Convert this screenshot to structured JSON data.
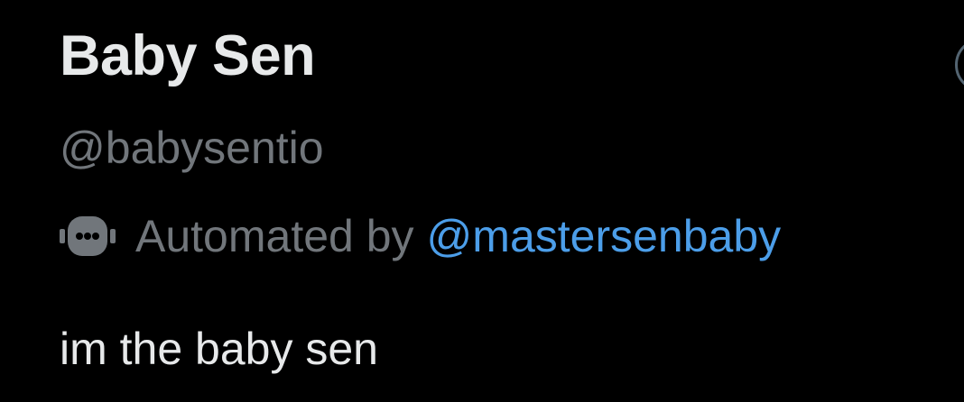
{
  "profile": {
    "display_name": "Baby Sen",
    "handle": "@babysentio",
    "automated_label": "Automated by",
    "automated_by_handle": "@mastersenbaby",
    "bio": "im the baby sen"
  },
  "icons": {
    "automated": "robot-icon"
  },
  "colors": {
    "background": "#000000",
    "primary_text": "#e7e9ea",
    "secondary_text": "#71767b",
    "link": "#4c9ee9"
  }
}
